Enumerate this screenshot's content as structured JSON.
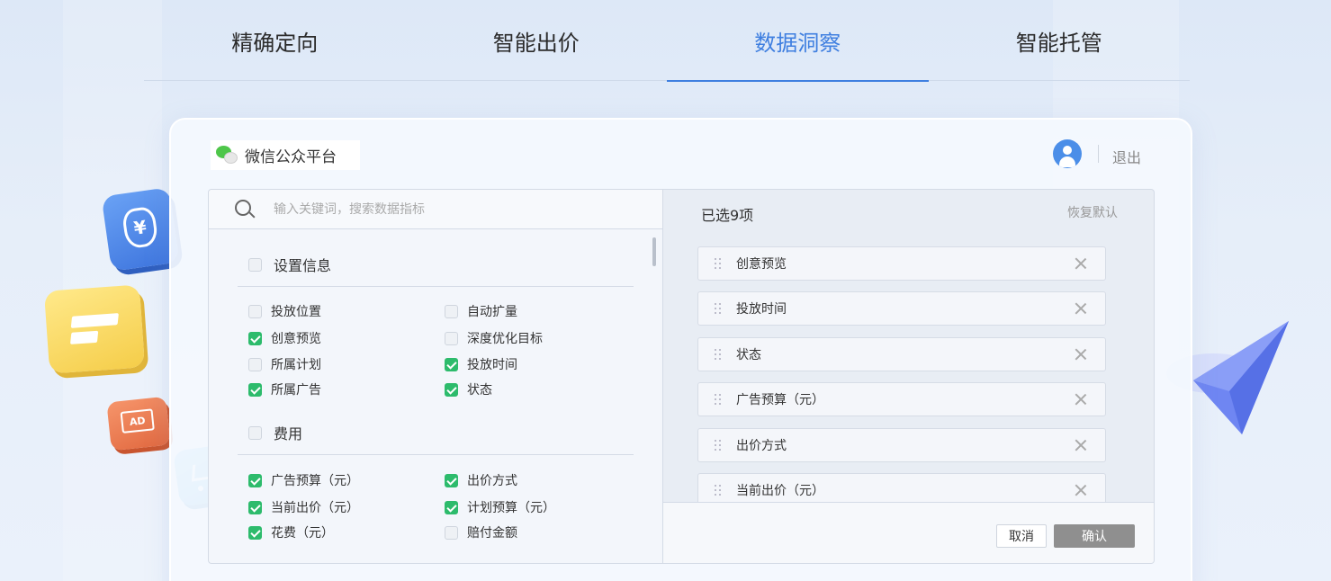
{
  "tabs": [
    {
      "label": "精确定向",
      "active": false
    },
    {
      "label": "智能出价",
      "active": false
    },
    {
      "label": "数据洞察",
      "active": true
    },
    {
      "label": "智能托管",
      "active": false
    }
  ],
  "header": {
    "brand": "微信公众平台",
    "logout": "退出"
  },
  "search": {
    "placeholder": "输入关键词，搜索数据指标",
    "value": ""
  },
  "groups": [
    {
      "label": "设置信息",
      "checked": false,
      "options": [
        {
          "label": "投放位置",
          "checked": false
        },
        {
          "label": "自动扩量",
          "checked": false
        },
        {
          "label": "创意预览",
          "checked": true
        },
        {
          "label": "深度优化目标",
          "checked": false
        },
        {
          "label": "所属计划",
          "checked": false
        },
        {
          "label": "投放时间",
          "checked": true
        },
        {
          "label": "所属广告",
          "checked": true
        },
        {
          "label": "状态",
          "checked": true
        }
      ]
    },
    {
      "label": "费用",
      "checked": false,
      "options": [
        {
          "label": "广告预算（元）",
          "checked": true
        },
        {
          "label": "出价方式",
          "checked": true
        },
        {
          "label": "当前出价（元）",
          "checked": true
        },
        {
          "label": "计划预算（元）",
          "checked": true
        },
        {
          "label": "花费（元）",
          "checked": true
        },
        {
          "label": "赔付金额",
          "checked": false
        }
      ]
    }
  ],
  "selected": {
    "count_label": "已选9项",
    "restore_label": "恢复默认",
    "items": [
      "创意预览",
      "投放时间",
      "状态",
      "广告预算（元）",
      "出价方式",
      "当前出价（元）"
    ]
  },
  "footer": {
    "cancel": "取消",
    "confirm": "确认"
  },
  "decor": {
    "money_symbol": "¥",
    "ad_text": "AD"
  },
  "colors": {
    "accent": "#3f7fe0",
    "check": "#2dbb6c",
    "confirm_btn": "#8f8f8f"
  }
}
